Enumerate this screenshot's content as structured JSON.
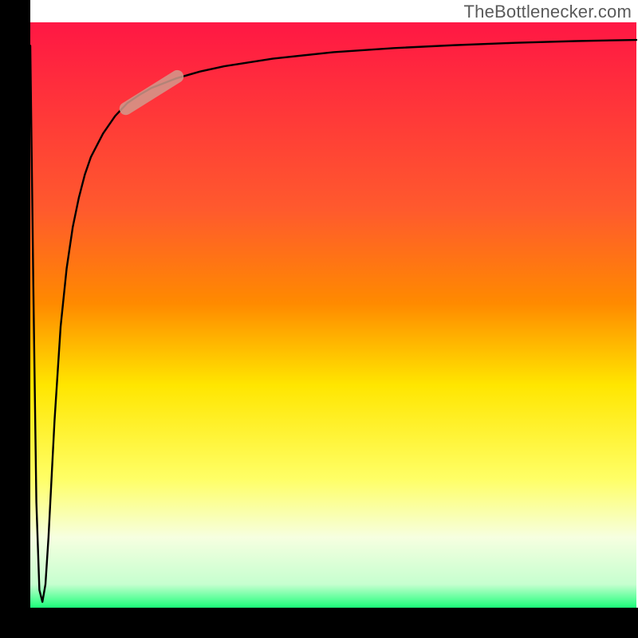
{
  "attribution": "TheBottlenecker.com",
  "chart_data": {
    "type": "line",
    "title": "",
    "xlabel": "",
    "ylabel": "",
    "xlim": [
      0,
      100
    ],
    "ylim": [
      0,
      100
    ],
    "background_gradient": {
      "top": "#ff1744",
      "mid1": "#ff8a00",
      "mid2": "#ffe600",
      "pale": "#f6ffe0",
      "bottom": "#1bff7a"
    },
    "series": [
      {
        "name": "bottleneck-curve",
        "x": [
          0.0,
          0.5,
          1.0,
          1.5,
          2.0,
          2.5,
          3.0,
          3.5,
          4.0,
          5.0,
          6.0,
          7.0,
          8.0,
          9.0,
          10,
          12,
          14,
          16,
          18,
          20,
          24,
          28,
          32,
          40,
          50,
          60,
          70,
          80,
          90,
          100
        ],
        "y": [
          96,
          55,
          18,
          3,
          1,
          4,
          12,
          22,
          32,
          48,
          58,
          65,
          70,
          74,
          77,
          81,
          84,
          86.2,
          87.6,
          88.8,
          90.4,
          91.6,
          92.5,
          93.8,
          94.9,
          95.6,
          96.1,
          96.5,
          96.8,
          97.0
        ]
      }
    ],
    "marker": {
      "name": "highlight-segment",
      "center_x": 20,
      "center_y": 88,
      "angle_deg": 32,
      "length": 10,
      "color": "#d39a8c",
      "opacity": 0.85
    },
    "axes": {
      "left_margin": 38,
      "bottom_margin": 38,
      "axis_color": "#000000"
    }
  }
}
